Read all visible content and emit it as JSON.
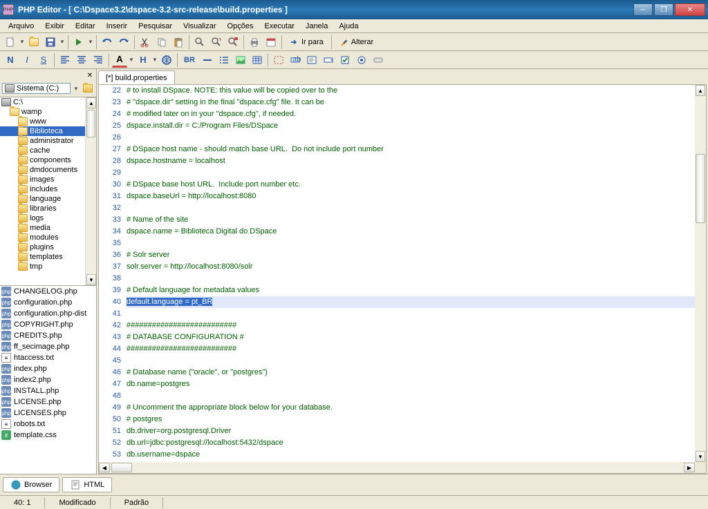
{
  "window": {
    "title": "PHP Editor - [ C:\\Dspace3.2\\dspace-3.2-src-release\\build.properties ]",
    "icon_label": "PHP"
  },
  "menu": [
    "Arquivo",
    "Exibir",
    "Editar",
    "Inserir",
    "Pesquisar",
    "Visualizar",
    "Opções",
    "Executar",
    "Janela",
    "Ajuda"
  ],
  "toolbar": {
    "irpara": "Ir para",
    "alterar": "Alterar"
  },
  "toolbar2": {
    "bold": "N",
    "italic": "I",
    "underline": "S",
    "font_a": "A",
    "h": "H",
    "br": "BR"
  },
  "drive": {
    "label": "Sistema (C:)"
  },
  "tree": [
    {
      "label": "C:\\",
      "indent": 0,
      "icon": "drive"
    },
    {
      "label": "wamp",
      "indent": 1,
      "icon": "folder-open"
    },
    {
      "label": "www",
      "indent": 2,
      "icon": "folder-open"
    },
    {
      "label": "Biblioteca",
      "indent": 2,
      "icon": "folder-open",
      "selected": true
    },
    {
      "label": "administrator",
      "indent": 2,
      "icon": "folder"
    },
    {
      "label": "cache",
      "indent": 2,
      "icon": "folder"
    },
    {
      "label": "components",
      "indent": 2,
      "icon": "folder"
    },
    {
      "label": "dmdocuments",
      "indent": 2,
      "icon": "folder"
    },
    {
      "label": "images",
      "indent": 2,
      "icon": "folder"
    },
    {
      "label": "includes",
      "indent": 2,
      "icon": "folder"
    },
    {
      "label": "language",
      "indent": 2,
      "icon": "folder"
    },
    {
      "label": "libraries",
      "indent": 2,
      "icon": "folder"
    },
    {
      "label": "logs",
      "indent": 2,
      "icon": "folder"
    },
    {
      "label": "media",
      "indent": 2,
      "icon": "folder"
    },
    {
      "label": "modules",
      "indent": 2,
      "icon": "folder"
    },
    {
      "label": "plugins",
      "indent": 2,
      "icon": "folder"
    },
    {
      "label": "templates",
      "indent": 2,
      "icon": "folder"
    },
    {
      "label": "tmp",
      "indent": 2,
      "icon": "folder"
    }
  ],
  "files": [
    {
      "name": "CHANGELOG.php",
      "type": "php"
    },
    {
      "name": "configuration.php",
      "type": "php"
    },
    {
      "name": "configuration.php-dist",
      "type": "php"
    },
    {
      "name": "COPYRIGHT.php",
      "type": "php"
    },
    {
      "name": "CREDITS.php",
      "type": "php"
    },
    {
      "name": "ff_secimage.php",
      "type": "php"
    },
    {
      "name": "htaccess.txt",
      "type": "txt"
    },
    {
      "name": "index.php",
      "type": "php"
    },
    {
      "name": "index2.php",
      "type": "php"
    },
    {
      "name": "INSTALL.php",
      "type": "php"
    },
    {
      "name": "LICENSE.php",
      "type": "php"
    },
    {
      "name": "LICENSES.php",
      "type": "php"
    },
    {
      "name": "robots.txt",
      "type": "txt"
    },
    {
      "name": "template.css",
      "type": "css"
    }
  ],
  "tab": {
    "label": "[*] build.properties"
  },
  "code": [
    {
      "n": 22,
      "t": "# to install DSpace. NOTE: this value will be copied over to the"
    },
    {
      "n": 23,
      "t": "# \"dspace.dir\" setting in the final \"dspace.cfg\" file. It can be"
    },
    {
      "n": 24,
      "t": "# modified later on in your \"dspace.cfg\", if needed."
    },
    {
      "n": 25,
      "t": "dspace.install.dir = C:/Program Files/DSpace"
    },
    {
      "n": 26,
      "t": ""
    },
    {
      "n": 27,
      "t": "# DSpace host name - should match base URL.  Do not include port number"
    },
    {
      "n": 28,
      "t": "dspace.hostname = localhost"
    },
    {
      "n": 29,
      "t": ""
    },
    {
      "n": 30,
      "t": "# DSpace base host URL.  Include port number etc."
    },
    {
      "n": 31,
      "t": "dspace.baseUrl = http://localhost:8080"
    },
    {
      "n": 32,
      "t": ""
    },
    {
      "n": 33,
      "t": "# Name of the site"
    },
    {
      "n": 34,
      "t": "dspace.name = Biblioteca Digital do DSpace"
    },
    {
      "n": 35,
      "t": ""
    },
    {
      "n": 36,
      "t": "# Solr server"
    },
    {
      "n": 37,
      "t": "solr.server = http://localhost:8080/solr"
    },
    {
      "n": 38,
      "t": ""
    },
    {
      "n": 39,
      "t": "# Default language for metadata values"
    },
    {
      "n": 40,
      "t": "default.language = pt_BR",
      "selected": true
    },
    {
      "n": 41,
      "t": ""
    },
    {
      "n": 42,
      "t": "##########################"
    },
    {
      "n": 43,
      "t": "# DATABASE CONFIGURATION #"
    },
    {
      "n": 44,
      "t": "##########################"
    },
    {
      "n": 45,
      "t": ""
    },
    {
      "n": 46,
      "t": "# Database name (\"oracle\", or \"postgres\")"
    },
    {
      "n": 47,
      "t": "db.name=postgres"
    },
    {
      "n": 48,
      "t": ""
    },
    {
      "n": 49,
      "t": "# Uncomment the appropriate block below for your database."
    },
    {
      "n": 50,
      "t": "# postgres"
    },
    {
      "n": 51,
      "t": "db.driver=org.postgresql.Driver"
    },
    {
      "n": 52,
      "t": "db.url=jdbc:postgresql://localhost:5432/dspace"
    },
    {
      "n": 53,
      "t": "db.username=dspace"
    }
  ],
  "bottom_tabs": {
    "browser": "Browser",
    "html": "HTML"
  },
  "status": {
    "pos": "40: 1",
    "modified": "Modificado",
    "padrao": "Padrão"
  }
}
